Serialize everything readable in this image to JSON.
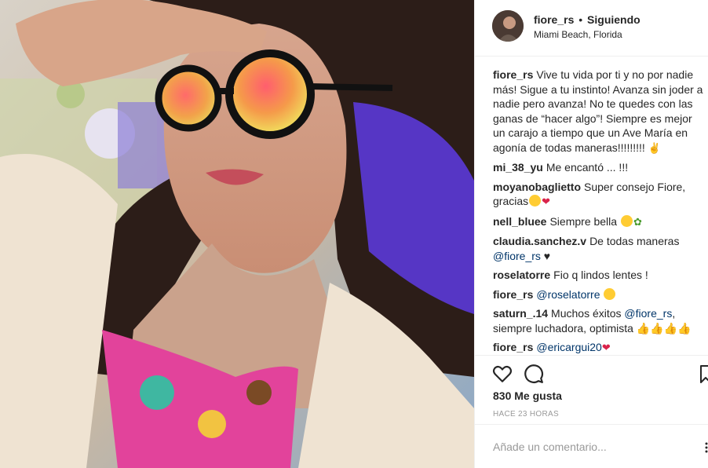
{
  "post": {
    "username": "fiore_rs",
    "follow_status": "Siguiendo",
    "location": "Miami Beach, Florida",
    "caption": "Vive tu vida por ti y no por nadie más! Sigue a tu instinto! Avanza sin joder a nadie pero avanza! No te quedes con las ganas de “hacer algo”! Siempre es mejor un carajo a tiempo que un Ave María en agonía de todas maneras!!!!!!!!!"
  },
  "comments": [
    {
      "user": "mi_38_yu",
      "text": "Me encantó ... !!!"
    },
    {
      "user": "moyanobaglietto",
      "text": "Super consejo Fiore, gracias"
    },
    {
      "user": "nell_bluee",
      "text": "Siempre bella"
    },
    {
      "user": "claudia.sanchez.v",
      "text": "De todas maneras",
      "mention": "@fiore_rs"
    },
    {
      "user": "roselatorre",
      "text": "Fio q lindos lentes !"
    },
    {
      "user": "fiore_rs",
      "mention": "@roselatorre"
    },
    {
      "user": "saturn_.14",
      "text": "Muchos éxitos",
      "mention": "@fiore_rs",
      "text2": ", siempre luchadora, optimista"
    },
    {
      "user": "fiore_rs",
      "mention": "@ericargui20"
    }
  ],
  "stats": {
    "likes": "830 Me gusta",
    "time_ago": "HACE 23 HORAS"
  },
  "input": {
    "placeholder": "Añade un comentario..."
  },
  "icons": {
    "like": "heart-icon",
    "comment": "comment-icon",
    "save": "bookmark-icon",
    "more": "more-options-icon"
  },
  "colors": {
    "mention": "#003569",
    "text": "#262626",
    "muted": "#999999",
    "divider": "#efefef"
  }
}
